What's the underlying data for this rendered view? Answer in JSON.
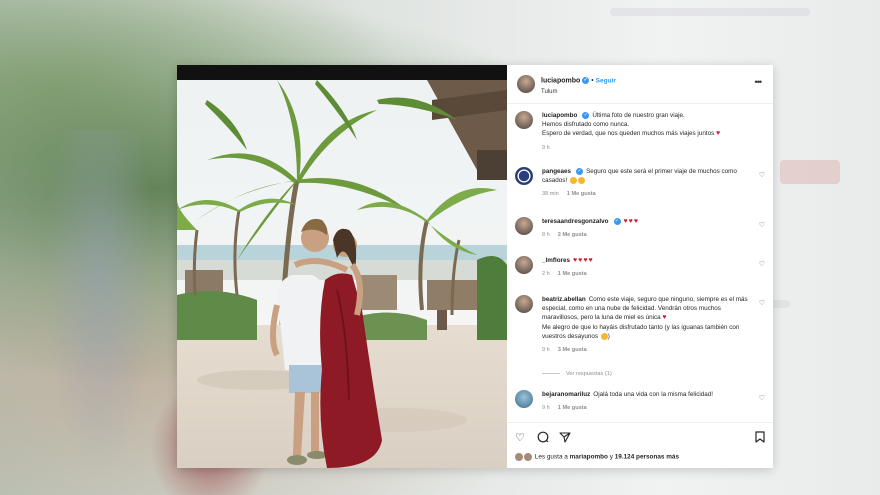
{
  "post": {
    "header": {
      "username": "luciapombo",
      "follow_label": "Seguir",
      "location": "Tulum"
    },
    "caption": {
      "username": "luciapombo",
      "lines": [
        "Última foto de nuestro gran viaje.",
        "Hemos disfrutado como nunca.",
        "Espero de verdad, que nos queden muchos más viajes juntos"
      ],
      "time": "9 h"
    },
    "comments": [
      {
        "username": "pangeaes",
        "text": "Seguro que este será el primer viaje de muchos como casados!",
        "time": "38 min",
        "likes": "1 Me gusta"
      },
      {
        "username": "teresaandresgonzalvo",
        "text": "",
        "time": "8 h",
        "likes": "2 Me gusta"
      },
      {
        "username": "_lmflores",
        "text": "",
        "time": "2 h",
        "likes": "1 Me gusta"
      },
      {
        "username": "beatriz.abellan",
        "text": "Como este viaje, seguro que ninguno, siempre es el más especial, como en una nube de felicidad. Vendrán otros muchos maravillosos, pero la luna de miel es única",
        "text2": "Me alegro de que lo hayáis disfrutado tanto (y las iguanas también con vuestros desayunos",
        "time": "9 h",
        "likes": "3 Me gusta"
      },
      {
        "username": "bejaranomariluz",
        "text": "Ojalá toda una vida con la misma felicidad!",
        "time": "9 h",
        "likes": "1 Me gusta"
      }
    ],
    "view_replies": "Ver respuestas (1)",
    "likes_line": {
      "prefix": "Les gusta a",
      "user": "mariapombo",
      "connector": "y",
      "count": "19.124 personas más"
    }
  },
  "icons": [
    "more-icon",
    "verified-icon",
    "heart-icon",
    "comment-icon",
    "share-icon",
    "bookmark-icon"
  ],
  "colors": {
    "accent": "#3897f0",
    "heart": "#d11b2e",
    "dress": "#8e1a25"
  }
}
